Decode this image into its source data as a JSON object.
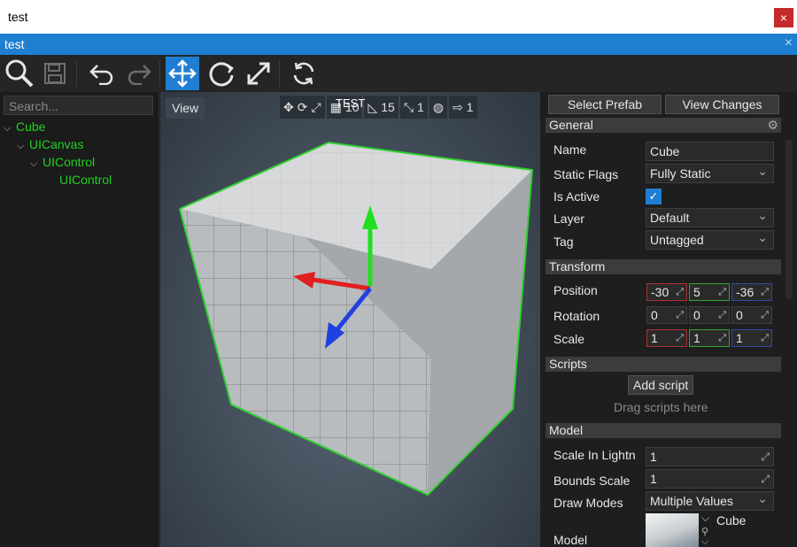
{
  "window": {
    "title": "test",
    "close_icon": "×"
  },
  "tab": {
    "label": "test",
    "close_icon": "×"
  },
  "toolbar": {
    "buttons": [
      "search-icon",
      "save-icon",
      "undo-icon",
      "redo-icon",
      "translate-icon",
      "rotate-icon",
      "scale-icon",
      "refresh-icon"
    ],
    "active": "translate-icon"
  },
  "tree": {
    "search_placeholder": "Search...",
    "items": [
      {
        "label": "Cube",
        "expanded": true
      },
      {
        "label": "UICanvas",
        "expanded": true
      },
      {
        "label": "UIControl",
        "expanded": true
      },
      {
        "label": "UIControl",
        "expanded": false
      }
    ]
  },
  "viewport": {
    "view_label": "View",
    "overlay_label": "TEST",
    "grid_snap": "10",
    "angle_snap": "15",
    "scale_snap": "1",
    "speed": "1"
  },
  "properties": {
    "select_prefab": "Select Prefab",
    "view_changes": "View Changes",
    "general": {
      "header": "General",
      "name_label": "Name",
      "name_value": "Cube",
      "static_flags_label": "Static Flags",
      "static_flags_value": "Fully Static",
      "is_active_label": "Is Active",
      "is_active": true,
      "layer_label": "Layer",
      "layer_value": "Default",
      "tag_label": "Tag",
      "tag_value": "Untagged"
    },
    "transform": {
      "header": "Transform",
      "position_label": "Position",
      "position": [
        "-30",
        "5",
        "-36"
      ],
      "rotation_label": "Rotation",
      "rotation": [
        "0",
        "0",
        "0"
      ],
      "scale_label": "Scale",
      "scale": [
        "1",
        "1",
        "1"
      ]
    },
    "scripts": {
      "header": "Scripts",
      "add_script": "Add script",
      "drag_hint": "Drag scripts here"
    },
    "model": {
      "header": "Model",
      "scale_in_lightmap_label": "Scale In Lightn",
      "scale_in_lightmap_value": "1",
      "bounds_scale_label": "Bounds Scale",
      "bounds_scale_value": "1",
      "draw_modes_label": "Draw Modes",
      "draw_modes_value": "Multiple Values",
      "model_label": "Model",
      "model_value": "Cube"
    }
  },
  "colors": {
    "accent": "#1f7ed1",
    "tree_text": "#1fd11f",
    "selection_outline": "#2fd12f",
    "axis_x": "#e02020",
    "axis_y": "#20e020",
    "axis_z": "#2040e0"
  }
}
